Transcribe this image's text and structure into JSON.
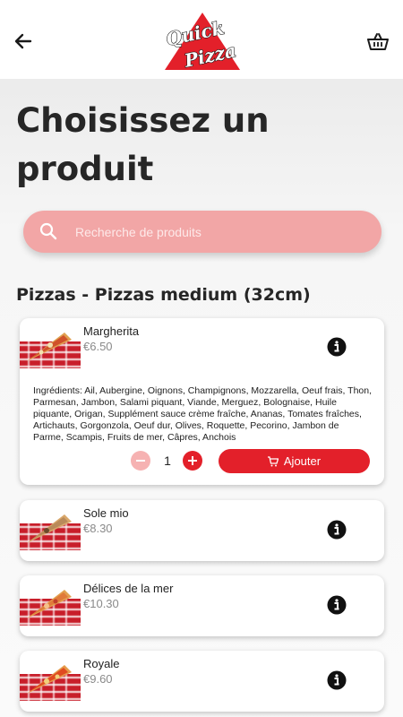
{
  "header": {
    "logo": {
      "line1": "Quick",
      "line2": "Pizza"
    },
    "back_icon": "arrow-left-icon",
    "cart_icon": "basket-icon"
  },
  "page_title": "Choisissez un produit",
  "search": {
    "placeholder": "Recherche de produits"
  },
  "section": {
    "title": "Pizzas - Pizzas medium (32cm)"
  },
  "products": [
    {
      "name": "Margherita",
      "price": "€6.50",
      "ingredients": "Ingrédients: Ail, Aubergine, Oignons, Champignons, Mozzarella, Oeuf frais, Thon, Parmesan, Jambon, Salami piquant, Viande, Merguez, Bolognaise, Huile piquante, Origan, Supplément sauce crème fraîche, Ananas, Tomates fraîches, Artichauts, Gorgonzola, Oeuf dur, Olives, Roquette, Pecorino, Jambon de Parme, Scampis, Fruits de mer, Câpres, Anchois",
      "quantity": "1",
      "add_label": "Ajouter"
    },
    {
      "name": "Sole mio",
      "price": "€8.30"
    },
    {
      "name": "Délices de la mer",
      "price": "€10.30"
    },
    {
      "name": "Royale",
      "price": "€9.60"
    }
  ],
  "colors": {
    "accent": "#e3202a",
    "accent_light": "#f2a6a6"
  }
}
